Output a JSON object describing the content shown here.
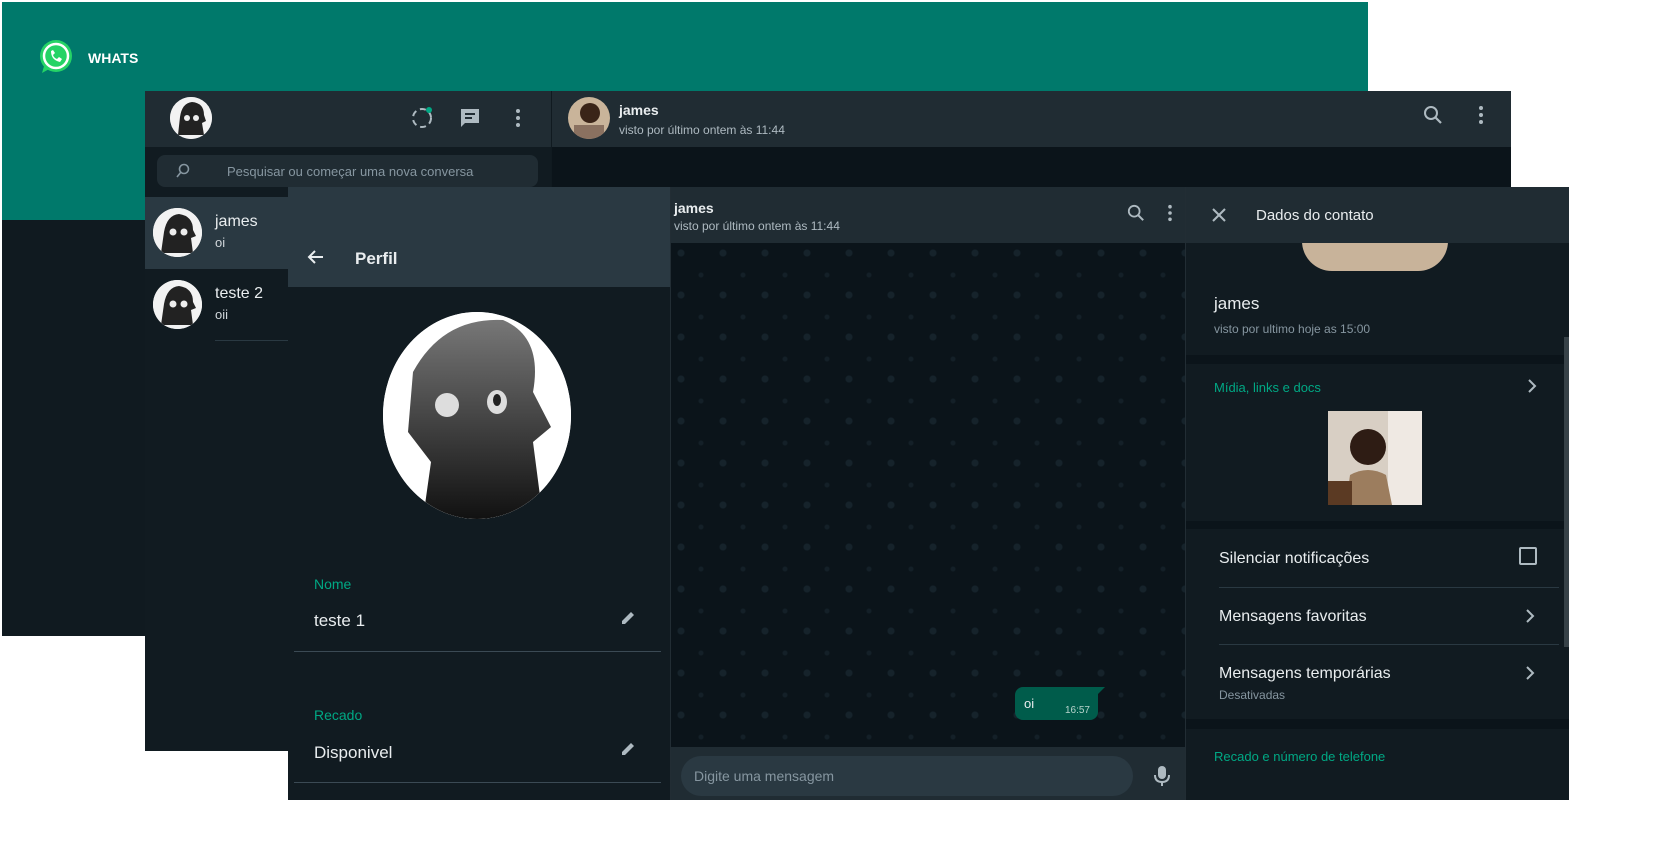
{
  "landing": {
    "brand": "WHATS"
  },
  "app": {
    "search": {
      "placeholder": "Pesquisar ou começar uma nova conversa"
    },
    "chats": [
      {
        "name": "james",
        "preview": "oi"
      },
      {
        "name": "teste 2",
        "preview": "oii"
      }
    ],
    "conversation": {
      "name": "james",
      "status": "visto por último ontem às 11:44"
    }
  },
  "profile": {
    "title": "Perfil",
    "name_label": "Nome",
    "name_value": "teste 1",
    "about_label": "Recado",
    "about_value": "Disponivel"
  },
  "chat": {
    "name": "james",
    "status": "visto por último ontem às 11:44",
    "messages": [
      {
        "text": "oi",
        "time": "16:57"
      }
    ],
    "composer_placeholder": "Digite uma mensagem"
  },
  "contact": {
    "title": "Dados do contato",
    "name": "james",
    "status": "visto por ultimo hoje as 15:00",
    "media_label": "Mídia, links e docs",
    "settings": [
      {
        "label": "Silenciar notificações"
      },
      {
        "label": "Mensagens favoritas"
      },
      {
        "label": "Mensagens temporárias",
        "sub": "Desativadas"
      }
    ],
    "about_label": "Recado e número de telefone"
  },
  "colors": {
    "brand_teal": "#00796b",
    "accent_green": "#00a884",
    "bubble_out": "#005c4b",
    "panel": "#111b21",
    "header": "#202c33"
  }
}
